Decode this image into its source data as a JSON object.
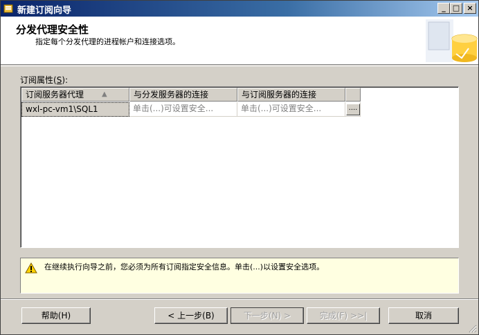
{
  "window": {
    "title": "新建订阅向导",
    "controls": {
      "minimize": "_",
      "maximize": "□",
      "close": "×"
    }
  },
  "header": {
    "title": "分发代理安全性",
    "subtitle": "指定每个分发代理的进程帐户和连接选项。"
  },
  "properties": {
    "label_prefix": "订阅属性(",
    "label_accel": "S",
    "label_suffix": "):",
    "columns": [
      "订阅服务器代理",
      "与分发服务器的连接",
      "与订阅服务器的连接"
    ],
    "sort_indicator": "▲",
    "rows": [
      {
        "agent": "wxl-pc-vm1\\SQL1",
        "distributor_conn": "单击(...)可设置安全...",
        "subscriber_conn": "单击(...)可设置安全...",
        "action": "...."
      }
    ]
  },
  "warning": {
    "text": "在继续执行向导之前，您必须为所有订阅指定安全信息。单击(...)以设置安全选项。"
  },
  "buttons": {
    "help": "帮助(H)",
    "back": "< 上一步(B)",
    "next": "下一步(N) >",
    "finish": "完成(F) >>|",
    "cancel": "取消"
  }
}
